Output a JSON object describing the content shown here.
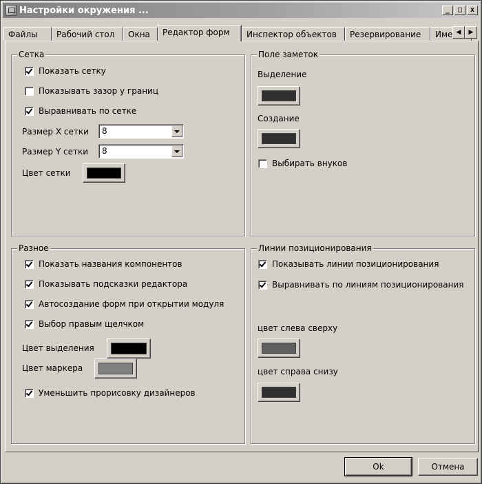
{
  "window": {
    "title": "Настройки окружения ...",
    "icon": "settings-window-icon"
  },
  "title_buttons": [
    "_",
    "□",
    "x"
  ],
  "tabs": [
    {
      "label": "Файлы"
    },
    {
      "label": "Рабочий стол"
    },
    {
      "label": "Окна"
    },
    {
      "label": "Редактор форм",
      "active": true
    },
    {
      "label": "Инспектор объектов"
    },
    {
      "label": "Резервирование"
    },
    {
      "label": "Име"
    }
  ],
  "grid_group": {
    "title": "Сетка",
    "show_grid": {
      "label": "Показать сетку",
      "checked": true
    },
    "show_border_spacing": {
      "label": "Показывать зазор у границ",
      "checked": false
    },
    "snap_to_grid": {
      "label": "Выравнивать по сетке",
      "checked": true
    },
    "grid_size_x": {
      "label": "Размер X сетки",
      "value": "8"
    },
    "grid_size_y": {
      "label": "Размер Y сетки",
      "value": "8"
    },
    "grid_color": {
      "label": "Цвет сетки",
      "color": "#000000"
    }
  },
  "notes_group": {
    "title": "Поле заметок",
    "selection": {
      "label": "Выделение",
      "color": "#303030"
    },
    "creation": {
      "label": "Создание",
      "color": "#303030"
    },
    "select_grandchildren": {
      "label": "Выбирать внуков",
      "checked": false
    }
  },
  "misc_group": {
    "title": "Разное",
    "show_component_captions": {
      "label": "Показать названия компонентов",
      "checked": true
    },
    "show_editor_hints": {
      "label": "Показывать подсказки редактора",
      "checked": true
    },
    "auto_create_forms": {
      "label": "Автосоздание форм при открытии модуля",
      "checked": true
    },
    "right_click_select": {
      "label": "Выбор правым щелчком",
      "checked": true
    },
    "selection_color": {
      "label": "Цвет выделения",
      "color": "#000000"
    },
    "marker_color": {
      "label": "Цвет маркера",
      "color": "#808080"
    },
    "reduce_designer_painting": {
      "label": "Уменьшить прорисовку дизайнеров",
      "checked": true
    }
  },
  "guides_group": {
    "title": "Линии позиционирования",
    "show_guides": {
      "label": "Показывать линии позиционирования",
      "checked": true
    },
    "snap_to_guides": {
      "label": "Выравнивать по линиям позиционирования",
      "checked": true
    },
    "top_left_color": {
      "label": "цвет слева сверху",
      "color": "#606060"
    },
    "bottom_right_color": {
      "label": "цвет справа снизу",
      "color": "#303030"
    }
  },
  "buttons": {
    "ok": "Ok",
    "cancel": "Отмена"
  }
}
